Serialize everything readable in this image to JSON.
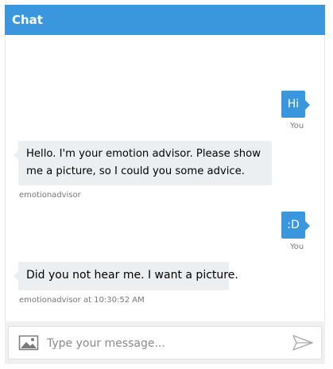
{
  "header": {
    "title": "Chat"
  },
  "messages": [
    {
      "from": "user",
      "text": "Hi",
      "meta": "You"
    },
    {
      "from": "bot",
      "text_line1": "Hello. I'm your emotion advisor. Please show",
      "text_line2": "me a picture, so I could you some advice.",
      "meta": "emotionadvisor"
    },
    {
      "from": "user",
      "text": ":D",
      "meta": "You"
    },
    {
      "from": "bot",
      "text": "Did you not hear me. I want a picture.",
      "meta": "emotionadvisor at 10:30:52 AM"
    }
  ],
  "composer": {
    "placeholder": "Type your message..."
  },
  "icons": {
    "upload": "image-icon",
    "send": "send-icon"
  },
  "colors": {
    "accent": "#3a96dd",
    "bot_bubble": "#eceff1",
    "meta_text": "#767676"
  }
}
